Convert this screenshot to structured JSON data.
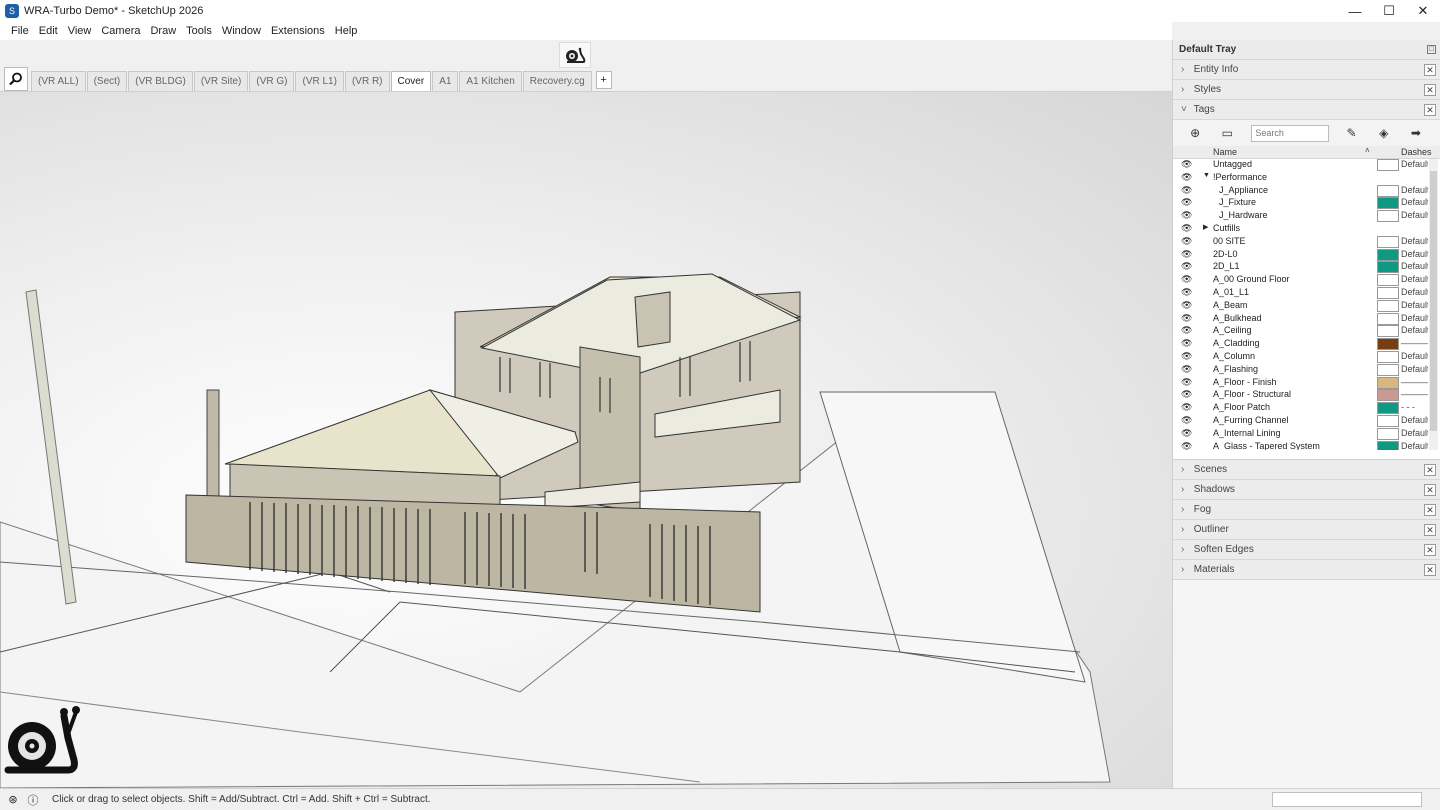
{
  "window": {
    "title": "WRA-Turbo Demo* - SketchUp 2026",
    "controls": {
      "minimize": "—",
      "maximize": "☐",
      "close": "✕"
    }
  },
  "menu": [
    "File",
    "Edit",
    "View",
    "Camera",
    "Draw",
    "Tools",
    "Window",
    "Extensions",
    "Help"
  ],
  "scene_tabs": [
    {
      "label": "(VR ALL)",
      "active": false
    },
    {
      "label": "(Sect)",
      "active": false
    },
    {
      "label": "(VR BLDG)",
      "active": false
    },
    {
      "label": "(VR Site)",
      "active": false
    },
    {
      "label": "(VR G)",
      "active": false
    },
    {
      "label": "(VR L1)",
      "active": false
    },
    {
      "label": "(VR R)",
      "active": false
    },
    {
      "label": "Cover",
      "active": true
    },
    {
      "label": "A1",
      "active": false
    },
    {
      "label": "A1 Kitchen",
      "active": false
    },
    {
      "label": "Recovery.cg",
      "active": false
    }
  ],
  "scene_add_label": "+",
  "status": {
    "text": "Click or drag to select objects. Shift = Add/Subtract. Ctrl = Add. Shift + Ctrl = Subtract."
  },
  "tray": {
    "title": "Default Tray",
    "panels_top": [
      "Entity Info",
      "Styles"
    ],
    "tags_panel": "Tags",
    "tags_search_placeholder": "Search",
    "tags_header": {
      "name": "Name",
      "dashes": "Dashes"
    },
    "tags": [
      {
        "name": "Untagged",
        "indent": 0,
        "color": "#ffffff",
        "dash": "Default"
      },
      {
        "name": "!Performance",
        "indent": 0,
        "folder": "open",
        "color": "",
        "dash": ""
      },
      {
        "name": "J_Appliance",
        "indent": 1,
        "color": "#ffffff",
        "dash": "Default"
      },
      {
        "name": "J_Fixture",
        "indent": 1,
        "color": "#0e9a82",
        "dash": "Default"
      },
      {
        "name": "J_Hardware",
        "indent": 1,
        "color": "#ffffff",
        "dash": "Default"
      },
      {
        "name": "Cutfills",
        "indent": 0,
        "folder": "closed",
        "color": "",
        "dash": ""
      },
      {
        "name": "00 SITE",
        "indent": 0,
        "color": "#ffffff",
        "dash": "Default"
      },
      {
        "name": "2D-L0",
        "indent": 0,
        "color": "#0e9a82",
        "dash": "Default"
      },
      {
        "name": "2D_L1",
        "indent": 0,
        "color": "#0e9a82",
        "dash": "Default"
      },
      {
        "name": "A_00 Ground Floor",
        "indent": 0,
        "color": "#ffffff",
        "dash": "Default"
      },
      {
        "name": "A_01_L1",
        "indent": 0,
        "color": "#ffffff",
        "dash": "Default"
      },
      {
        "name": "A_Beam",
        "indent": 0,
        "color": "#ffffff",
        "dash": "Default"
      },
      {
        "name": "A_Bulkhead",
        "indent": 0,
        "color": "#ffffff",
        "dash": "Default"
      },
      {
        "name": "A_Ceiling",
        "indent": 0,
        "color": "#ffffff",
        "dash": "Default"
      },
      {
        "name": "A_Cladding",
        "indent": 0,
        "color": "#7a3d10",
        "dash": "———"
      },
      {
        "name": "A_Column",
        "indent": 0,
        "color": "#ffffff",
        "dash": "Default"
      },
      {
        "name": "A_Flashing",
        "indent": 0,
        "color": "#ffffff",
        "dash": "Default"
      },
      {
        "name": "A_Floor - Finish",
        "indent": 0,
        "color": "#d9b87f",
        "dash": "———"
      },
      {
        "name": "A_Floor - Structural",
        "indent": 0,
        "color": "#c99a94",
        "dash": "———"
      },
      {
        "name": "A_Floor Patch",
        "indent": 0,
        "color": "#0e9a82",
        "dash": "- - -"
      },
      {
        "name": "A_Furring Channel",
        "indent": 0,
        "color": "#ffffff",
        "dash": "Default"
      },
      {
        "name": "A_Internal Lining",
        "indent": 0,
        "color": "#ffffff",
        "dash": "Default"
      },
      {
        "name": "A_Glass - Tapered System",
        "indent": 0,
        "color": "#0e9a82",
        "dash": "Default"
      }
    ],
    "panels_bottom": [
      "Scenes",
      "Shadows",
      "Fog",
      "Outliner",
      "Soften Edges",
      "Materials"
    ]
  },
  "icons": {
    "search": "search-icon",
    "snail": "snail-icon",
    "eye": "eye-icon",
    "tag_colors_teal": "#0e9a82"
  }
}
